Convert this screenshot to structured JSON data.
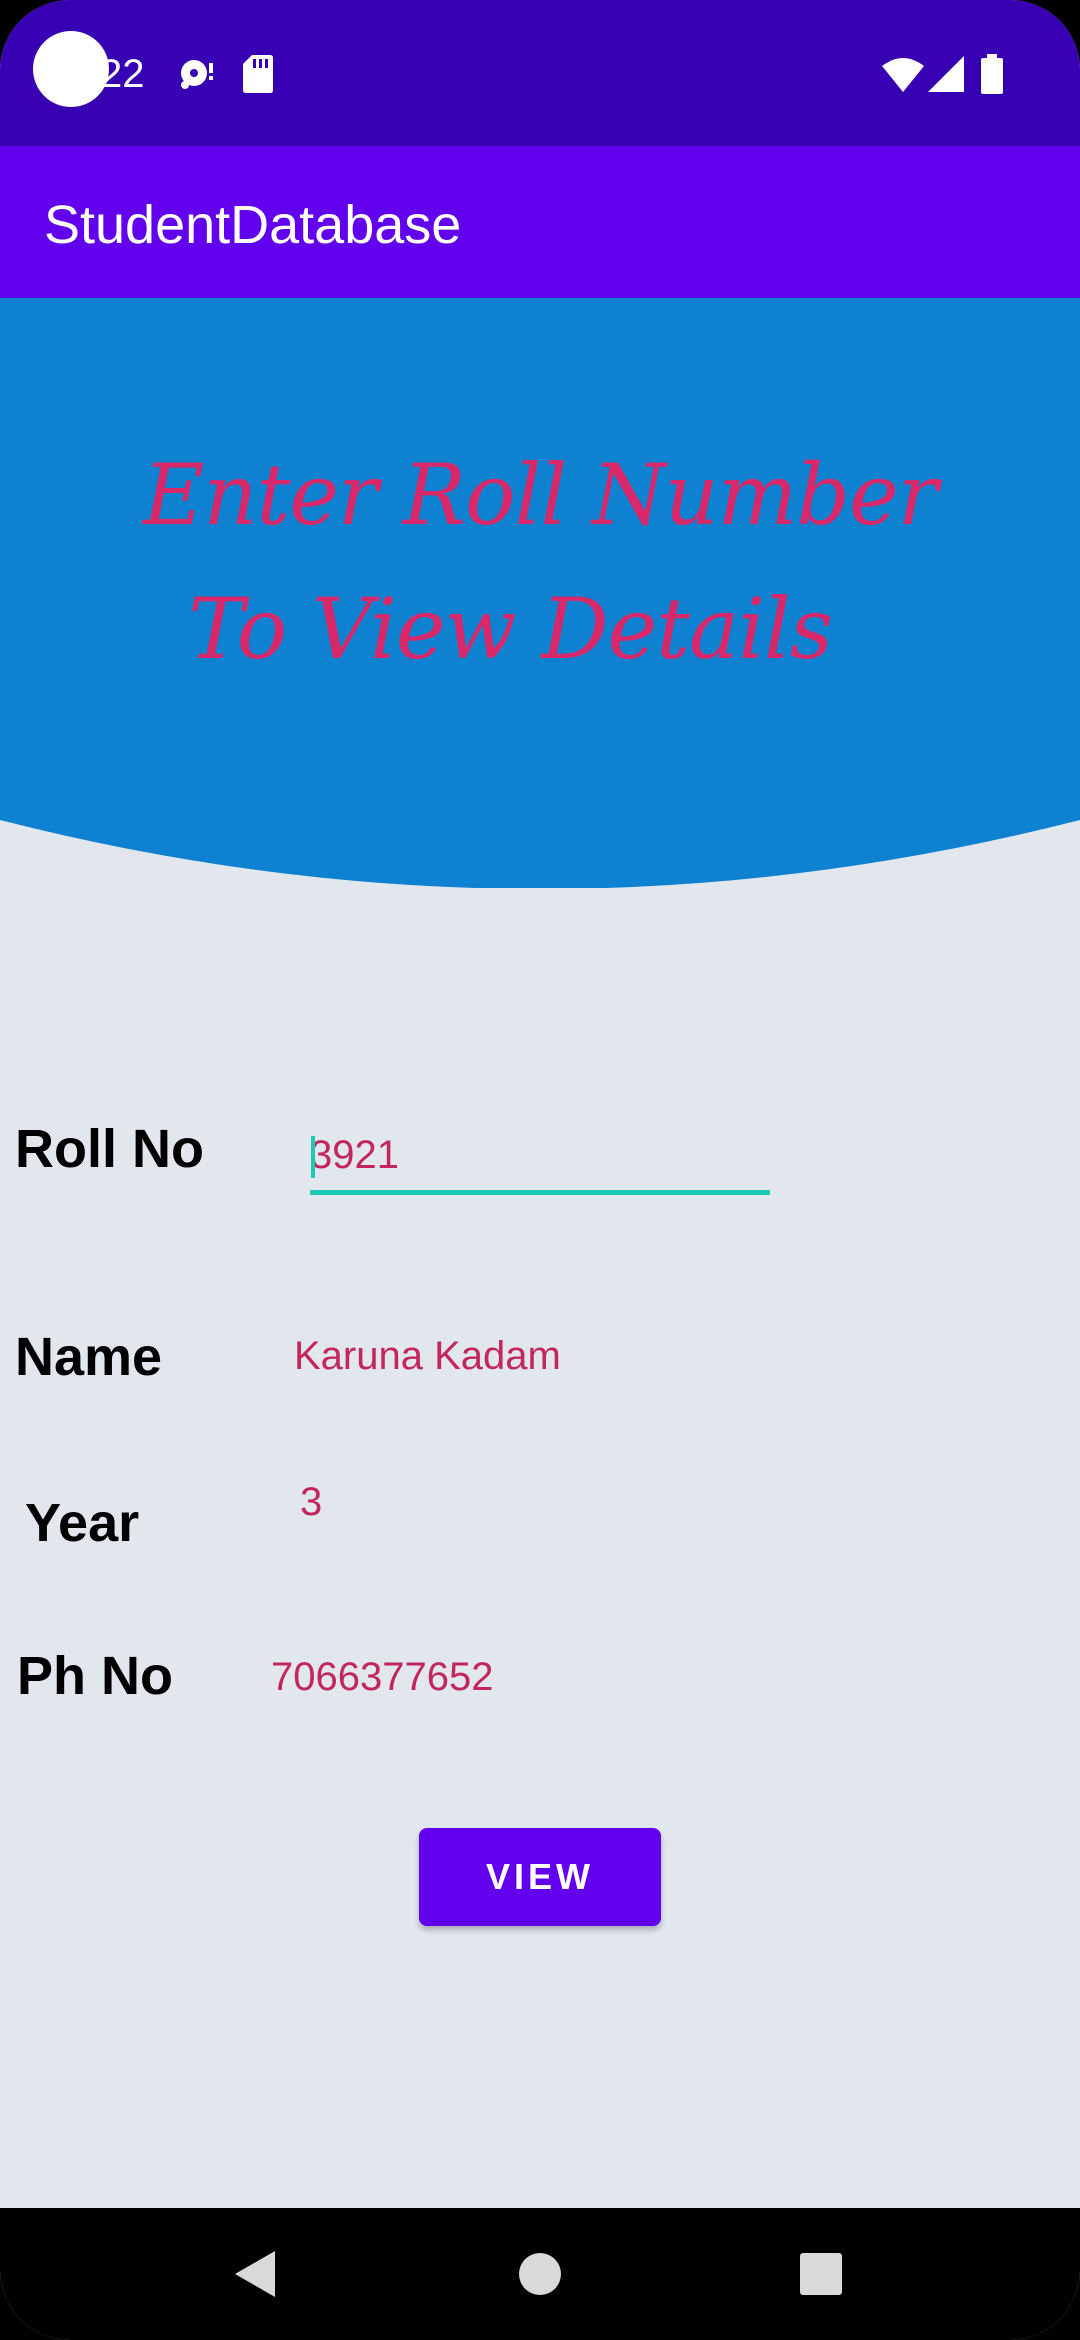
{
  "status_bar": {
    "time": "22",
    "icons": [
      "camera-dot",
      "disk-icon",
      "sd-card-icon",
      "wifi-icon",
      "signal-icon",
      "battery-icon"
    ],
    "background": "#3700b3"
  },
  "app_bar": {
    "title": "StudentDatabase",
    "background": "#6200ee"
  },
  "banner": {
    "line1": "Enter Roll Number",
    "line2": "To View Details",
    "background": "#0e82d1",
    "text_color": "#d8286a"
  },
  "form": {
    "roll_no_label": "Roll No",
    "roll_no_value": "3921",
    "name_label": "Name",
    "name_value": "Karuna Kadam",
    "year_label": "Year",
    "year_value": "3",
    "phone_label": "Ph No",
    "phone_value": "7066377652",
    "accent_color": "#1bcab5",
    "value_color": "#c2265c"
  },
  "view_button": {
    "label": "VIEW"
  },
  "nav_bar": {
    "icons": [
      "back-icon",
      "home-icon",
      "recents-icon"
    ]
  }
}
